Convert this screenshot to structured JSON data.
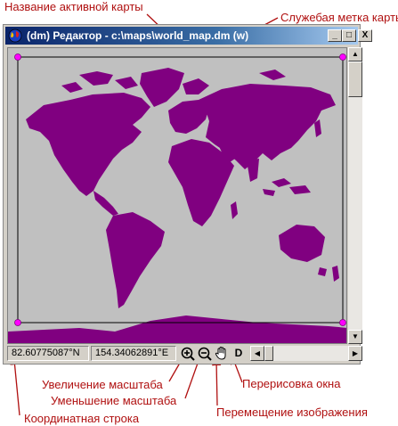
{
  "annotations": {
    "active_map_name": "Название активной карты",
    "service_label": "Служебая метка карты",
    "zoom_in": "Увеличение масштаба",
    "zoom_out": "Уменьшение масштаба",
    "coord_line": "Координатная строка",
    "redraw": "Перерисовка окна",
    "pan": "Перемещение изображения"
  },
  "window": {
    "title": "(dm) Редактор - c:\\maps\\world_map.dm (w)",
    "minimize_label": "_",
    "maximize_label": "□",
    "close_label": "X"
  },
  "status": {
    "latitude": "82.60775087°N",
    "longitude": "154.34062891°E",
    "redraw_label": "D"
  },
  "icons": {
    "zoom_in": "zoom-in-icon",
    "zoom_out": "zoom-out-icon",
    "pan": "hand-icon"
  },
  "colors": {
    "land": "#800080",
    "sea": "#c0c0c0",
    "annotation": "#b01010",
    "selection_handle": "#ff00ff"
  }
}
